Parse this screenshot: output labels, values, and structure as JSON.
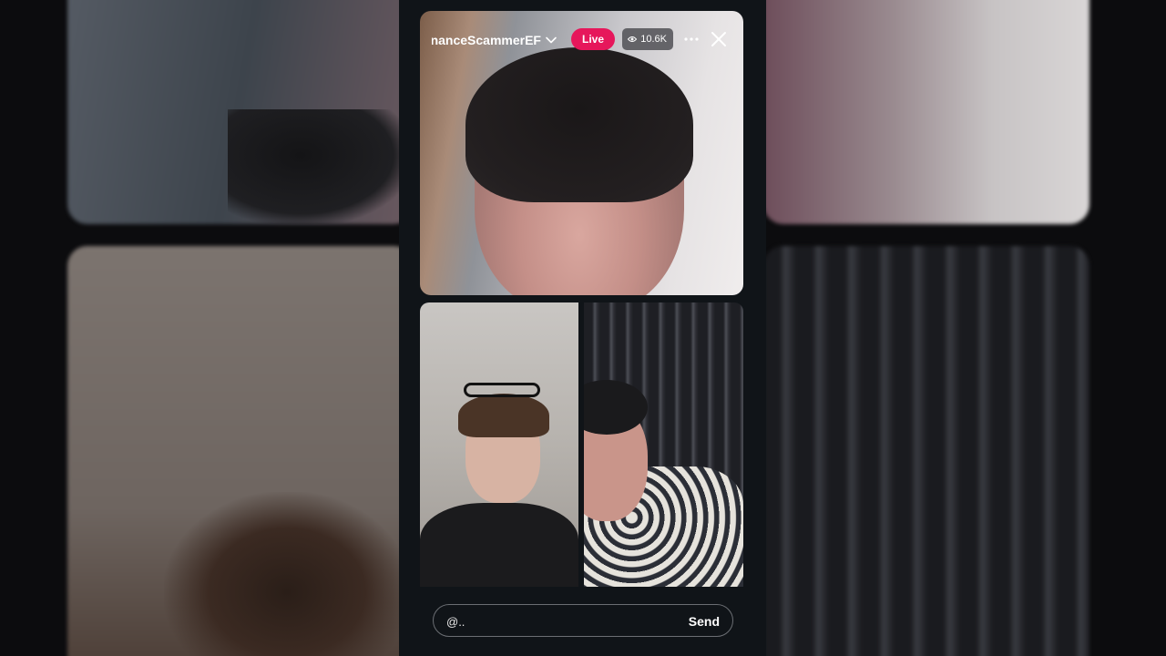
{
  "stream": {
    "username": "nanceScammerEF",
    "live_label": "Live",
    "viewer_count": "10.6K"
  },
  "icons": {
    "dropdown": "chevron-down-icon",
    "viewers": "eye-icon",
    "more": "more-options-icon",
    "close": "close-icon"
  },
  "comment": {
    "placeholder": "@..",
    "send_label": "Send"
  },
  "colors": {
    "live_badge": "#e6175b",
    "panel_bg": "#101418"
  }
}
